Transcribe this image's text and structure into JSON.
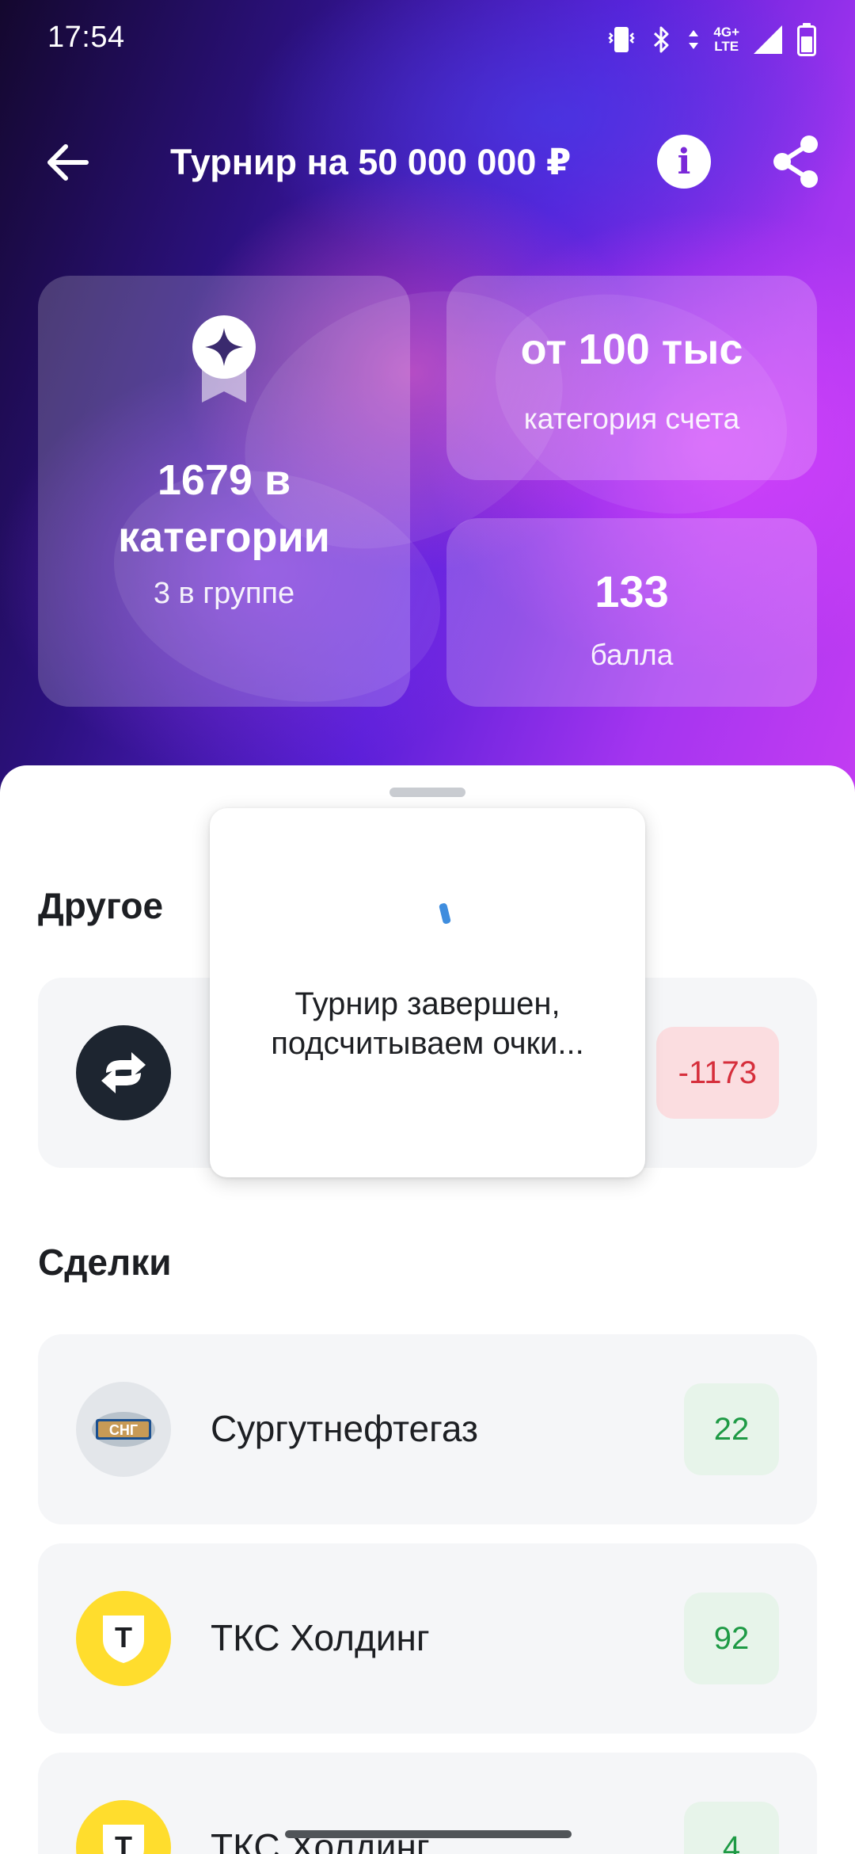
{
  "status_bar": {
    "time": "17:54",
    "network": "4G+",
    "network_sub": "LTE",
    "icons": [
      "vibrate-icon",
      "bluetooth-icon",
      "data-arrows-icon",
      "signal-icon",
      "battery-icon"
    ]
  },
  "header": {
    "title": "Турнир на 50 000 000 ₽",
    "info_symbol": "i"
  },
  "stats": {
    "rank_value": "1679 в категории",
    "rank_sub": "3 в группе",
    "category_value": "от 100 тыс",
    "category_sub": "категория счета",
    "points_value": "133",
    "points_sub": "балла"
  },
  "sections": {
    "other_title": "Другое",
    "deals_title": "Сделки"
  },
  "other_items": [
    {
      "name": "",
      "value": "-1173",
      "icon": "transfer-arrows-icon"
    }
  ],
  "deals": [
    {
      "name": "Сургутнефтегаз",
      "value": "22",
      "logo_text": "СНГ"
    },
    {
      "name": "ТКС Холдинг",
      "value": "92",
      "logo_text": "Т"
    },
    {
      "name": "ТКС Холдинг",
      "value": "4",
      "logo_text": "Т"
    }
  ],
  "modal": {
    "message": "Турнир завершен, подсчитываем очки..."
  },
  "colors": {
    "badge_green_text": "#1e9a45",
    "badge_green_bg": "#e7f4ea",
    "badge_red_text": "#d62f3c",
    "badge_red_bg": "#fbdde0",
    "tks_yellow": "#ffdd2d",
    "accent_purple": "#7a28d8"
  }
}
